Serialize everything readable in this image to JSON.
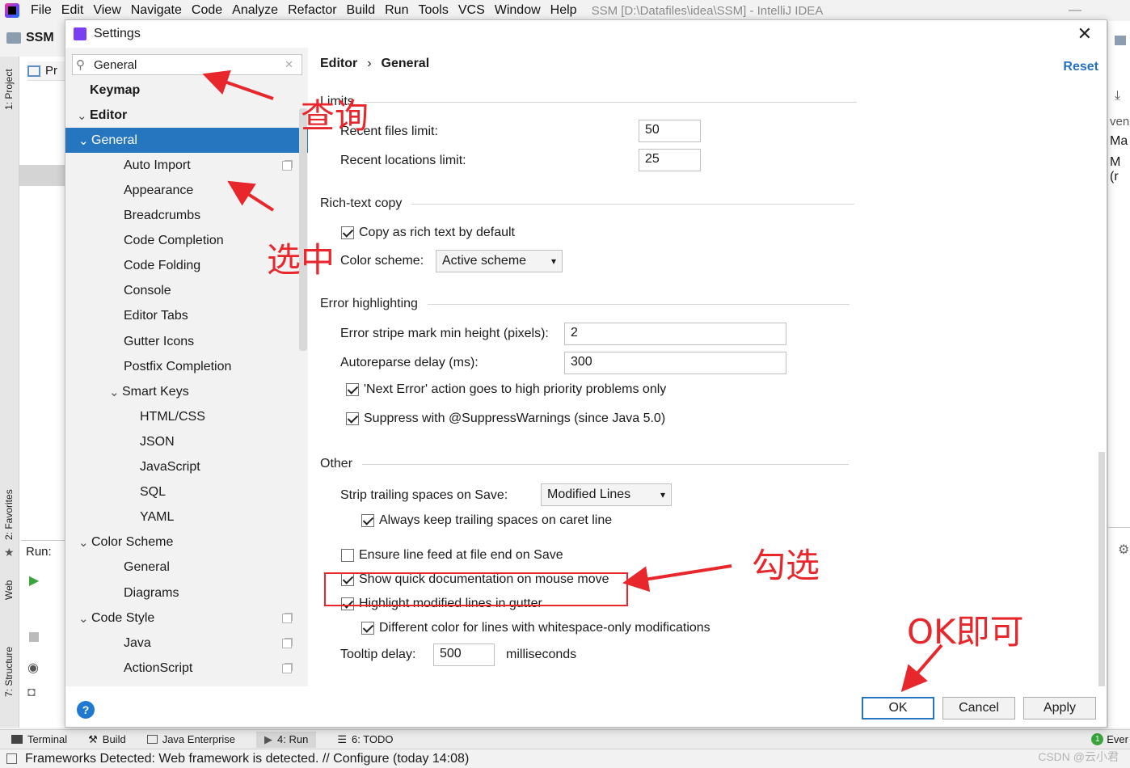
{
  "menubar": {
    "items": [
      "File",
      "Edit",
      "View",
      "Navigate",
      "Code",
      "Analyze",
      "Refactor",
      "Build",
      "Run",
      "Tools",
      "VCS",
      "Window",
      "Help"
    ],
    "window_title": "SSM [D:\\Datafiles\\idea\\SSM] - IntelliJ IDEA"
  },
  "ide": {
    "project_name": "SSM",
    "proj_tab_stub": "Pr",
    "run_label": "Run:",
    "left_tools": [
      "1: Project",
      "2: Favorites",
      "Web",
      "7: Structure"
    ],
    "right_stubs": [
      "ven",
      "Ma",
      "M (r"
    ],
    "bottom_tabs": [
      "Terminal",
      "Build",
      "Java Enterprise",
      "4: Run",
      "6: TODO"
    ],
    "bottom_right_stub": "Ever",
    "status": "Frameworks Detected: Web framework is detected. // Configure (today 14:08)",
    "watermark": "CSDN @云小君"
  },
  "dialog": {
    "title": "Settings",
    "search_value": "General",
    "breadcrumb": [
      "Editor",
      "General"
    ],
    "reset_label": "Reset",
    "tree": [
      {
        "label": "Keymap",
        "level": 0,
        "bold": true
      },
      {
        "label": "Editor",
        "level": 0,
        "bold": true,
        "expanded": true
      },
      {
        "label": "General",
        "level": 1,
        "expanded": true,
        "selected": true
      },
      {
        "label": "Auto Import",
        "level": 2,
        "copy": true
      },
      {
        "label": "Appearance",
        "level": 2
      },
      {
        "label": "Breadcrumbs",
        "level": 2
      },
      {
        "label": "Code Completion",
        "level": 2
      },
      {
        "label": "Code Folding",
        "level": 2
      },
      {
        "label": "Console",
        "level": 2
      },
      {
        "label": "Editor Tabs",
        "level": 2
      },
      {
        "label": "Gutter Icons",
        "level": 2
      },
      {
        "label": "Postfix Completion",
        "level": 2
      },
      {
        "label": "Smart Keys",
        "level": 2,
        "expanded": true
      },
      {
        "label": "HTML/CSS",
        "level": 3
      },
      {
        "label": "JSON",
        "level": 3
      },
      {
        "label": "JavaScript",
        "level": 3
      },
      {
        "label": "SQL",
        "level": 3
      },
      {
        "label": "YAML",
        "level": 3
      },
      {
        "label": "Color Scheme",
        "level": 1,
        "expanded": true
      },
      {
        "label": "General",
        "level": 2
      },
      {
        "label": "Diagrams",
        "level": 2
      },
      {
        "label": "Code Style",
        "level": 1,
        "expanded": true,
        "copy": true
      },
      {
        "label": "Java",
        "level": 2,
        "copy": true
      },
      {
        "label": "ActionScript",
        "level": 2,
        "copy": true
      }
    ],
    "limits": {
      "title": "Limits",
      "recent_files_label": "Recent files limit:",
      "recent_files_value": "50",
      "recent_locations_label": "Recent locations limit:",
      "recent_locations_value": "25"
    },
    "rich_text": {
      "title": "Rich-text copy",
      "copy_default_label": "Copy as rich text by default",
      "copy_default_checked": true,
      "scheme_label": "Color scheme:",
      "scheme_value": "Active scheme"
    },
    "error_highlighting": {
      "title": "Error highlighting",
      "stripe_label": "Error stripe mark min height (pixels):",
      "stripe_value": "2",
      "autoreparse_label": "Autoreparse delay (ms):",
      "autoreparse_value": "300",
      "next_error_label": "'Next Error' action goes to high priority problems only",
      "next_error_checked": true,
      "suppress_label": "Suppress with @SuppressWarnings (since Java 5.0)",
      "suppress_checked": true
    },
    "other": {
      "title": "Other",
      "strip_label": "Strip trailing spaces on Save:",
      "strip_value": "Modified Lines",
      "keep_trailing_label": "Always keep trailing spaces on caret line",
      "keep_trailing_checked": true,
      "line_feed_label": "Ensure line feed at file end on Save",
      "line_feed_checked": false,
      "quick_doc_label": "Show quick documentation on mouse move",
      "quick_doc_checked": true,
      "highlight_label": "Highlight modified lines in gutter",
      "highlight_checked": true,
      "diff_color_label": "Different color for lines with whitespace-only modifications",
      "diff_color_checked": true,
      "tooltip_label": "Tooltip delay:",
      "tooltip_value": "500",
      "tooltip_unit": "milliseconds"
    },
    "buttons": {
      "ok": "OK",
      "cancel": "Cancel",
      "apply": "Apply"
    }
  },
  "annotations": {
    "search_note": "查询",
    "select_note": "选中",
    "check_note": "勾选",
    "ok_note": "OK即可",
    "color": "#e8272c"
  }
}
